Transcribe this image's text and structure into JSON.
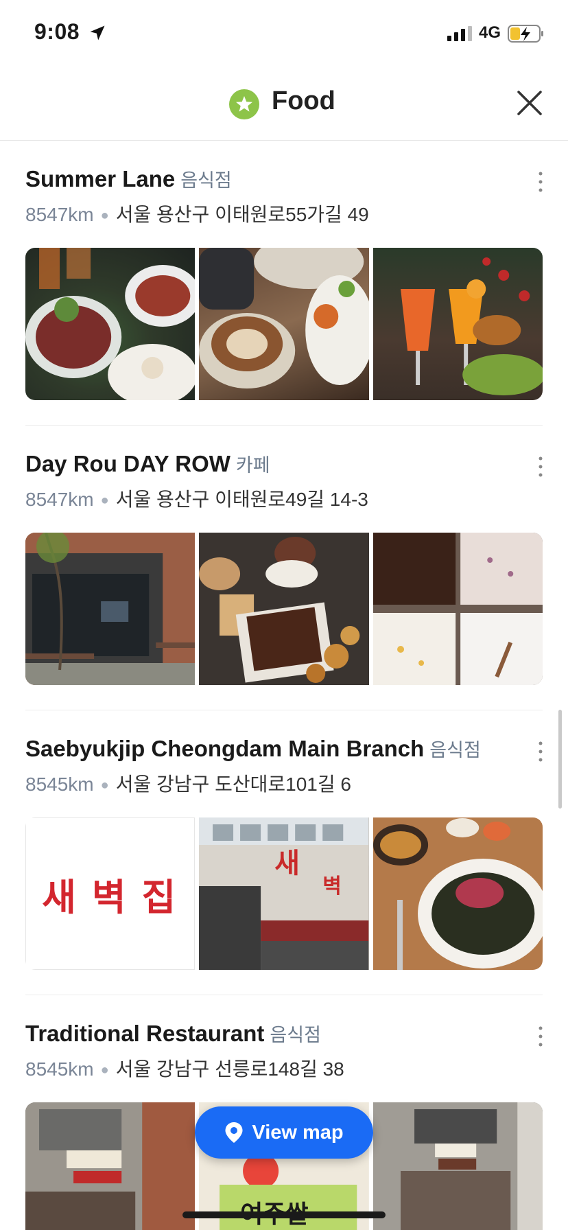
{
  "status": {
    "time": "9:08",
    "network": "4G"
  },
  "header": {
    "title": "Food",
    "close_icon": "close-icon",
    "badge_icon": "star-icon"
  },
  "places": [
    {
      "name": "Summer Lane",
      "category": "음식점",
      "distance": "8547km",
      "address": "서울 용산구 이태원로55가길 49"
    },
    {
      "name": "Day Rou DAY ROW",
      "category": "카페",
      "distance": "8547km",
      "address": "서울 용산구 이태원로49길 14-3"
    },
    {
      "name": "Saebyukjip Cheongdam Main Branch",
      "category": "음식점",
      "distance": "8545km",
      "address": "서울 강남구 도산대로101길 6",
      "logo_text": "새 벽 집"
    },
    {
      "name": "Traditional Restaurant",
      "category": "음식점",
      "distance": "8545km",
      "address": "서울 강남구 선릉로148길 38"
    }
  ],
  "view_map": {
    "label": "View map"
  },
  "colors": {
    "accent": "#1a6bf5",
    "badge": "#8dc449",
    "category": "#6b7a8c"
  }
}
